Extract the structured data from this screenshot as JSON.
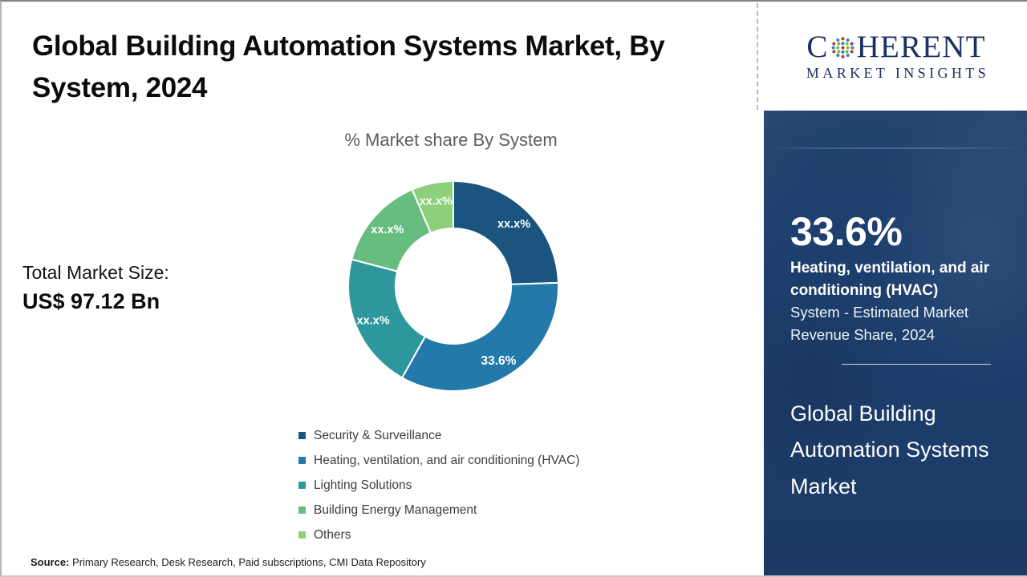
{
  "header": {
    "title": "Global Building Automation Systems Market, By System, 2024"
  },
  "chart_subtitle": "% Market share By System",
  "total_market": {
    "label": "Total Market Size:",
    "value": "US$ 97.12 Bn"
  },
  "source": {
    "label": "Source:",
    "text": " Primary Research, Desk Research, Paid subscriptions, CMI Data Repository"
  },
  "logo": {
    "name": "COHERENT",
    "name_pre": "C",
    "name_post": "HERENT",
    "tagline": "MARKET INSIGHTS",
    "globe_icon": "globe-dots-icon",
    "color": "#1b2f63"
  },
  "right_panel": {
    "stat_value": "33.6%",
    "stat_desc_bold": "Heating, ventilation, and air conditioning (HVAC)",
    "stat_desc": "System - Estimated Market Revenue Share, 2024",
    "market_name": "Global Building Automation Systems Market",
    "background_color": "#1d3f6e"
  },
  "chart_data": {
    "type": "pie",
    "variant": "donut",
    "title": "Global Building Automation Systems Market, By System, 2024",
    "subtitle": "% Market share By System",
    "xlabel": "",
    "ylabel": "",
    "units": "percent of market share",
    "legend_position": "bottom",
    "grid": false,
    "start_angle_deg": 0,
    "direction": "clockwise",
    "inner_radius_ratio": 0.55,
    "categories": [
      "Security & Surveillance",
      "Heating, ventilation, and air conditioning (HVAC)",
      "Lighting Solutions",
      "Building Energy Management",
      "Others"
    ],
    "values": [
      24.5,
      33.6,
      21.0,
      14.5,
      6.4
    ],
    "data_labels": [
      "xx.x%",
      "33.6%",
      "xx.x%",
      "xx.x%",
      "xx.x%"
    ],
    "colors": [
      "#1a547f",
      "#2379a9",
      "#2e979e",
      "#66bd7f",
      "#8ed07a"
    ],
    "annotations": [
      "Total Market Size: US$ 97.12 Bn",
      "33.6% Heating, ventilation, and air conditioning (HVAC) System - Estimated Market Revenue Share, 2024"
    ]
  }
}
